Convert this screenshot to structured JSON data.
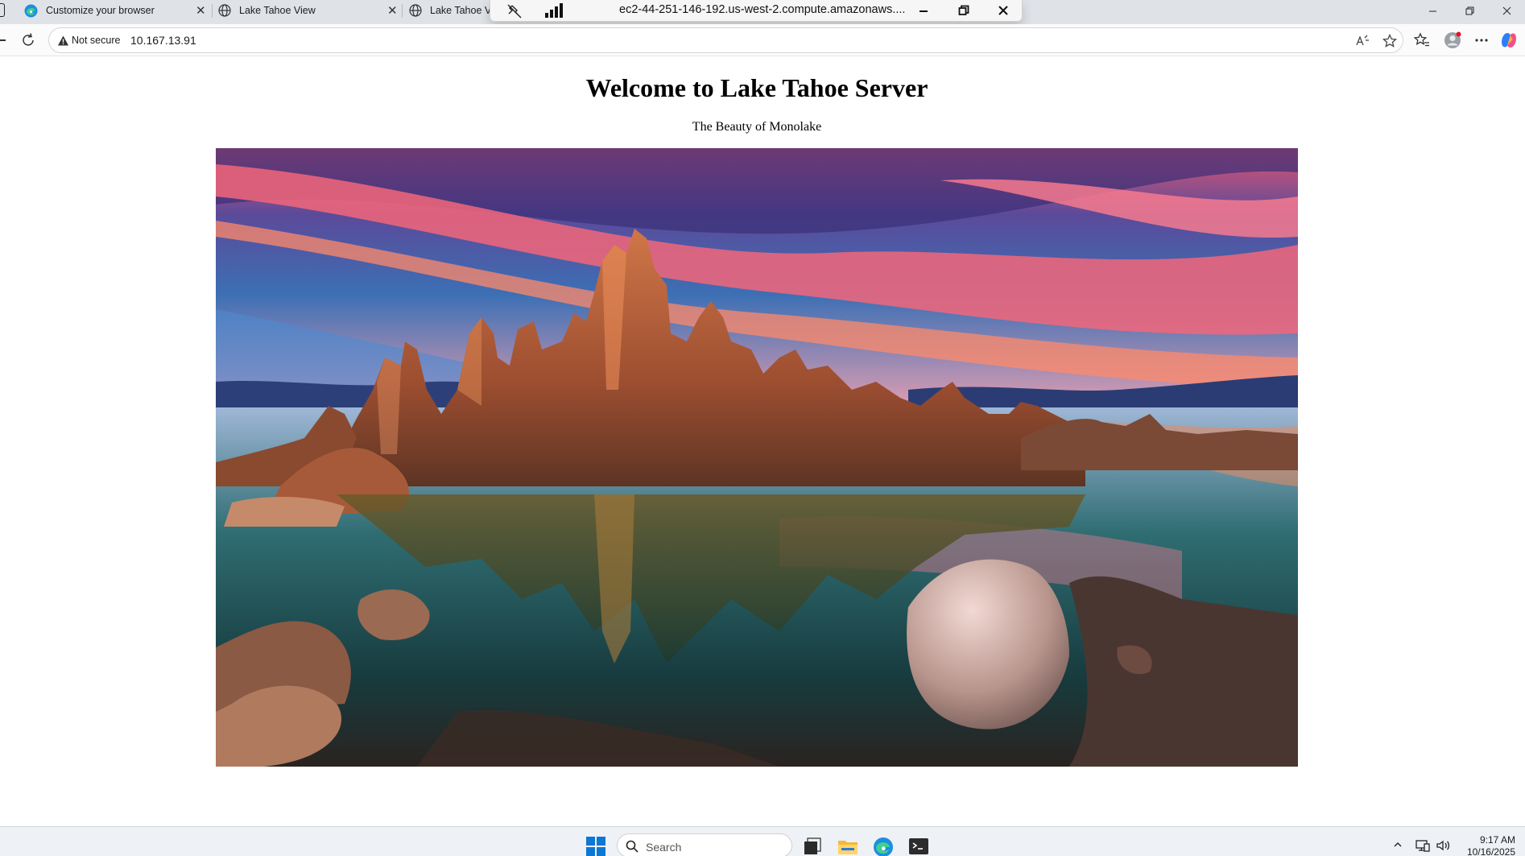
{
  "browser": {
    "tabs": [
      {
        "title": "Customize your browser",
        "icon": "edge-icon",
        "active": false
      },
      {
        "title": "Lake Tahoe View",
        "icon": "globe-icon",
        "active": false
      },
      {
        "title": "Lake Tahoe Vi",
        "icon": "globe-icon",
        "active": true
      }
    ],
    "address_bar": {
      "security_label": "Not secure",
      "url": "10.167.13.91"
    },
    "toolbar_icons": [
      "read-aloud-icon",
      "favorite-star-icon",
      "favorites-icon",
      "profile-avatar-icon",
      "more-menu-icon",
      "copilot-icon"
    ]
  },
  "remote_session": {
    "host": "ec2-44-251-146-192.us-west-2.compute.amazonaws....",
    "icons": [
      "unpin-icon",
      "signal-strength-icon",
      "minimize-icon",
      "restore-icon",
      "close-icon"
    ]
  },
  "page": {
    "heading": "Welcome to Lake Tahoe Server",
    "subtitle": "The Beauty of Monolake",
    "hero_image": "Tufa rock towers reflected in a calm lake under a vivid pink and orange sunset sky"
  },
  "taskbar": {
    "search_placeholder": "Search",
    "apps": [
      "task-view-icon",
      "file-explorer-icon",
      "edge-browser-icon",
      "terminal-icon"
    ],
    "tray_icons": [
      "show-hidden-icons-chevron",
      "network-icon",
      "volume-icon"
    ],
    "time": "9:17 AM",
    "date": "10/16/2025"
  },
  "colors": {
    "tabstrip_bg": "#dfe3e8",
    "sky_pink": "#f2667a",
    "sky_blue": "#2e3f86",
    "rock_orange": "#b45a35",
    "taskbar_bg": "#eef1f5"
  }
}
